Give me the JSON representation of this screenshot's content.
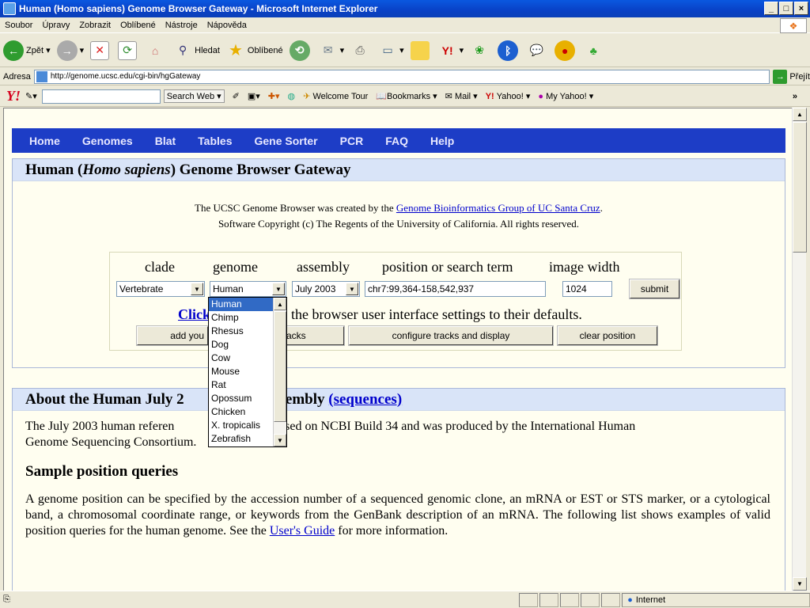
{
  "window": {
    "title": "Human (Homo sapiens) Genome Browser Gateway - Microsoft Internet Explorer",
    "btn_min": "_",
    "btn_max": "□",
    "btn_close": "×"
  },
  "menu": [
    "Soubor",
    "Úpravy",
    "Zobrazit",
    "Oblíbené",
    "Nástroje",
    "Nápověda"
  ],
  "toolbar": {
    "back": "Zpět",
    "search": "Hledat",
    "favorites": "Oblíbené"
  },
  "address": {
    "label": "Adresa",
    "url": "http://genome.ucsc.edu/cgi-bin/hgGateway",
    "go": "Přejít"
  },
  "yahoo": {
    "logo": "Y!",
    "search_web": "Search Web",
    "welcome": "Welcome Tour",
    "bookmarks": "Bookmarks",
    "mail": "Mail",
    "yahoo": "Yahoo!",
    "myyahoo": "My Yahoo!",
    "more": "»"
  },
  "nav": [
    "Home",
    "Genomes",
    "Blat",
    "Tables",
    "Gene Sorter",
    "PCR",
    "FAQ",
    "Help"
  ],
  "gateway": {
    "title_pre": "Human (",
    "title_it": "Homo sapiens",
    "title_post": ") Genome Browser Gateway",
    "credit1": "The UCSC Genome Browser was created by the ",
    "credit_link": "Genome Bioinformatics Group of UC Santa Cruz",
    "credit1_end": ".",
    "credit2": "Software Copyright (c) The Regents of the University of California. All rights reserved."
  },
  "form": {
    "labels": {
      "clade": "clade",
      "genome": "genome",
      "assembly": "assembly",
      "position": "position or search term",
      "width": "image width"
    },
    "clade": "Vertebrate",
    "genome": "Human",
    "assembly": "July 2003",
    "position": "chr7:99,364-158,542,937",
    "width": "1024",
    "submit": "submit",
    "click_link": "Click",
    "click_rest": " the browser user interface settings to their defaults.",
    "btn_add": "add you",
    "btn_tracks": "acks",
    "btn_config": "configure tracks and display",
    "btn_clear": "clear position"
  },
  "genome_options": [
    "Human",
    "Chimp",
    "Rhesus",
    "Dog",
    "Cow",
    "Mouse",
    "Rat",
    "Opossum",
    "Chicken",
    "X. tropicalis",
    "Zebrafish"
  ],
  "about": {
    "title_pre": "About the Human July 2",
    "title_mid": "assembly ",
    "title_link": "(sequences)",
    "p1a": "The July 2003 human referen",
    "p1b": "is based on NCBI Build 34 and was produced by the International Human",
    "p1c": "Genome Sequencing Consortium.",
    "sample_head": "Sample position queries",
    "p2": "A genome position can be specified by the accession number of a sequenced genomic clone, an mRNA or EST or STS marker, or a cytological band, a chromosomal coordinate range, or keywords from the GenBank description of an mRNA. The following list shows examples of valid position queries for the human genome. See the ",
    "p2_link": "User's Guide",
    "p2_end": "for more information."
  },
  "status": {
    "zone": "Internet"
  }
}
